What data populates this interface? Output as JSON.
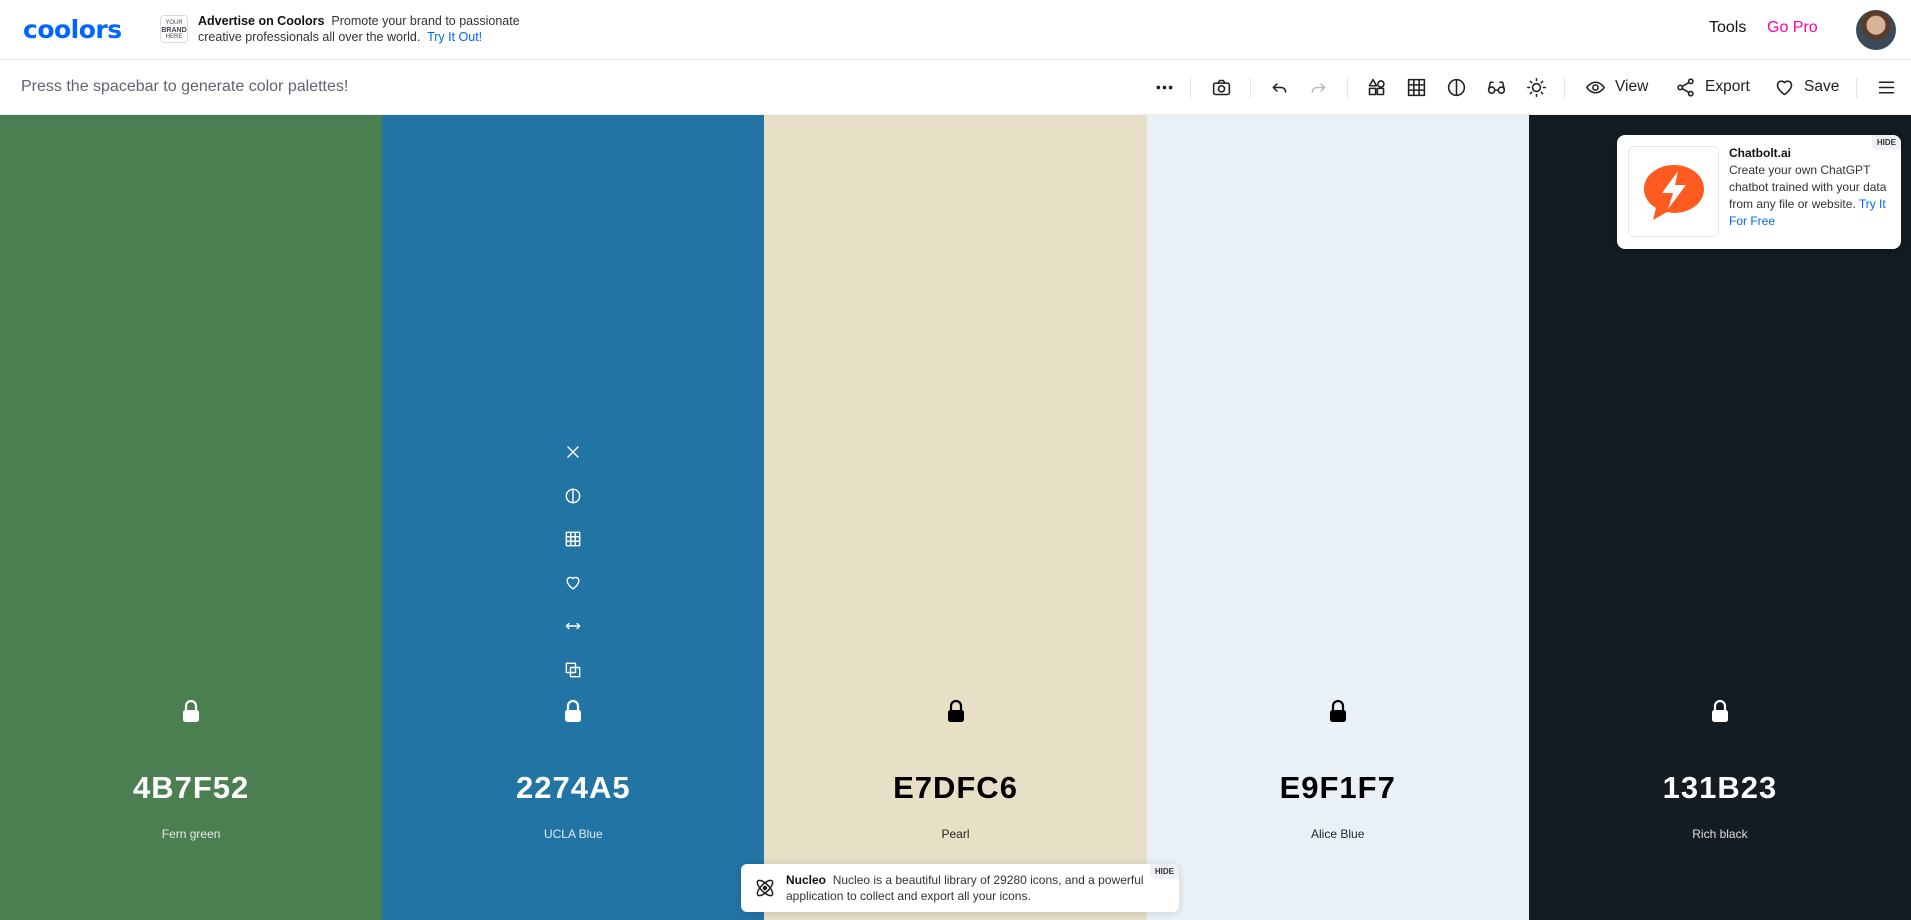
{
  "header": {
    "logo": "coolors",
    "ad_brand_lines": [
      "YOUR",
      "BRAND",
      "HERE"
    ],
    "ad_title": "Advertise on Coolors",
    "ad_body": "Promote your brand to passionate creative professionals all over the world.",
    "ad_link": "Try It Out!",
    "tools_label": "Tools",
    "gopro_label": "Go Pro",
    "avatar_icon": "user-avatar"
  },
  "toolbar": {
    "hint": "Press the spacebar to generate color palettes!",
    "view_label": "View",
    "export_label": "Export",
    "save_label": "Save",
    "icons": [
      "more-icon",
      "camera-icon",
      "undo-icon",
      "redo-icon",
      "shapes-icon",
      "grid-icon",
      "contrast-icon",
      "glasses-icon",
      "sun-icon",
      "eye-icon",
      "share-icon",
      "heart-icon",
      "menu-icon"
    ]
  },
  "palette": [
    {
      "hex": "4B7F52",
      "name": "Fern green",
      "color": "#4B7F52",
      "text": "#ffffff",
      "locked": false
    },
    {
      "hex": "2274A5",
      "name": "UCLA Blue",
      "color": "#2274A5",
      "text": "#ffffff",
      "locked": false
    },
    {
      "hex": "E7DFC6",
      "name": "Pearl",
      "color": "#E7DFC6",
      "text": "#000000",
      "locked": false
    },
    {
      "hex": "E9F1F7",
      "name": "Alice Blue",
      "color": "#E9F1F7",
      "text": "#000000",
      "locked": false
    },
    {
      "hex": "131B23",
      "name": "Rich black",
      "color": "#131B23",
      "text": "#ffffff",
      "locked": false
    }
  ],
  "color_tools": [
    "close-icon",
    "contrast-icon",
    "grid-icon",
    "heart-icon",
    "drag-icon",
    "copy-icon",
    "lock-icon"
  ],
  "chat_ad": {
    "title": "Chatbolt.ai",
    "body": "Create your own ChatGPT chatbot trained with your data from any file or website.",
    "link": "Try It For Free",
    "hide": "HIDE",
    "brand_color": "#ff5a1f"
  },
  "nucleo_ad": {
    "title": "Nucleo",
    "body": "Nucleo is a beautiful library of 29280 icons, and a powerful application to collect and export all your icons.",
    "hide": "HIDE"
  },
  "colors": {
    "accent": "#0066ff",
    "pro": "#ff00aa"
  }
}
